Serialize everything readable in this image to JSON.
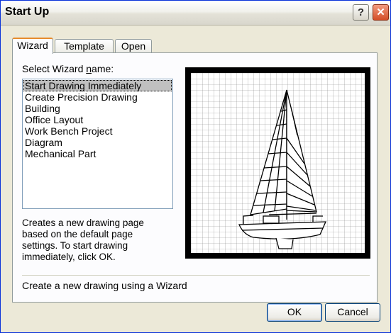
{
  "window": {
    "title": "Start Up"
  },
  "titlebar": {
    "help_label": "?",
    "close_label": "✕"
  },
  "tabs": [
    {
      "label": "Wizard",
      "active": true
    },
    {
      "label": "Template",
      "active": false
    },
    {
      "label": "Open",
      "active": false
    }
  ],
  "wizard": {
    "select_label_pre": "Select Wizard ",
    "select_label_underline": "n",
    "select_label_post": "ame:",
    "items": [
      "Start Drawing Immediately",
      "Create Precision Drawing",
      "Building",
      "Office Layout",
      "Work Bench Project",
      "Diagram",
      "Mechanical Part"
    ],
    "selected_index": 0,
    "description_lines": [
      "Creates a new drawing page",
      "based on the default page",
      "settings.  To start drawing",
      "immediately, click OK."
    ]
  },
  "status_text": "Create a new drawing using a Wizard",
  "buttons": {
    "ok": "OK",
    "cancel": "Cancel"
  }
}
